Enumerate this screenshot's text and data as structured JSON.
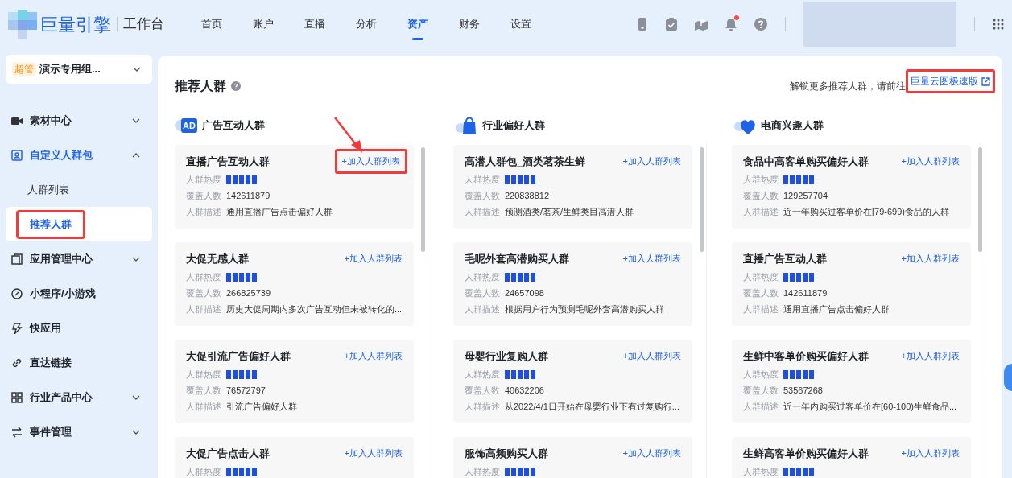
{
  "header": {
    "brand": "巨量引擎",
    "product": "工作台",
    "nav": [
      {
        "label": "首页",
        "selected": false
      },
      {
        "label": "账户",
        "selected": false
      },
      {
        "label": "直播",
        "selected": false
      },
      {
        "label": "分析",
        "selected": false
      },
      {
        "label": "资产",
        "selected": true
      },
      {
        "label": "财务",
        "selected": false
      },
      {
        "label": "设置",
        "selected": false
      }
    ],
    "notification_badge": true
  },
  "sidebar": {
    "account": {
      "badge": "超管",
      "name": "演示专用组..."
    },
    "items": [
      {
        "label": "素材中心",
        "expanded": false,
        "selected": false
      },
      {
        "label": "自定义人群包",
        "expanded": true,
        "selected": true,
        "children": [
          {
            "label": "人群列表",
            "selected": false,
            "highlighted": false
          },
          {
            "label": "推荐人群",
            "selected": true,
            "highlighted": true
          }
        ]
      },
      {
        "label": "应用管理中心",
        "expanded": false,
        "selected": false
      },
      {
        "label": "小程序/小游戏",
        "selected": false
      },
      {
        "label": "快应用",
        "selected": false
      },
      {
        "label": "直达链接",
        "selected": false
      },
      {
        "label": "行业产品中心",
        "expanded": false,
        "selected": false
      },
      {
        "label": "事件管理",
        "expanded": false,
        "selected": false
      }
    ]
  },
  "main": {
    "title": "推荐人群",
    "unlock_text": "解锁更多推荐人群，请前往",
    "unlock_link": {
      "label": "巨量云图极速版",
      "highlighted": true
    },
    "columns": [
      {
        "title": "广告互动人群",
        "icon_text": "AD",
        "cards": [
          {
            "name": "直播广告互动人群",
            "action": "+加入人群列表",
            "action_highlighted": true,
            "heat_label": "人群热度",
            "stars": 5,
            "coverage_label": "覆盖人数",
            "coverage": "142611879",
            "desc_label": "人群描述",
            "desc": "通用直播广告点击偏好人群"
          },
          {
            "name": "大促无感人群",
            "action": "+加入人群列表",
            "action_highlighted": false,
            "heat_label": "人群热度",
            "stars": 5,
            "coverage_label": "覆盖人数",
            "coverage": "266825739",
            "desc_label": "人群描述",
            "desc": "历史大促周期内多次广告互动但未被转化的..."
          },
          {
            "name": "大促引流广告偏好人群",
            "action": "+加入人群列表",
            "action_highlighted": false,
            "heat_label": "人群热度",
            "stars": 5,
            "coverage_label": "覆盖人数",
            "coverage": "76572797",
            "desc_label": "人群描述",
            "desc": "引流广告偏好人群"
          },
          {
            "name": "大促广告点击人群",
            "action": "+加入人群列表",
            "action_highlighted": false,
            "heat_label": "人群热度",
            "stars": 5
          }
        ]
      },
      {
        "title": "行业偏好人群",
        "cards": [
          {
            "name": "高潜人群包_酒类茗茶生鲜",
            "action": "+加入人群列表",
            "action_highlighted": false,
            "heat_label": "人群热度",
            "stars": 5,
            "coverage_label": "覆盖人数",
            "coverage": "220838812",
            "desc_label": "人群描述",
            "desc": "预测酒类/茗茶/生鲜类目高潜人群"
          },
          {
            "name": "毛呢外套高潜购买人群",
            "action": "+加入人群列表",
            "action_highlighted": false,
            "heat_label": "人群热度",
            "stars": 5,
            "coverage_label": "覆盖人数",
            "coverage": "24657098",
            "desc_label": "人群描述",
            "desc": "根据用户行为预测毛呢外套高潜购买人群"
          },
          {
            "name": "母婴行业复购人群",
            "action": "+加入人群列表",
            "action_highlighted": false,
            "heat_label": "人群热度",
            "stars": 5,
            "coverage_label": "覆盖人数",
            "coverage": "40632206",
            "desc_label": "人群描述",
            "desc": "从2022/4/1日开始在母婴行业下有过复购行..."
          },
          {
            "name": "服饰高频购买人群",
            "action": "+加入人群列表",
            "action_highlighted": false,
            "heat_label": "人群热度",
            "stars": 5
          }
        ]
      },
      {
        "title": "电商兴趣人群",
        "cards": [
          {
            "name": "食品中高客单购买偏好人群",
            "action": "+加入人群列表",
            "action_highlighted": false,
            "heat_label": "人群热度",
            "stars": 5,
            "coverage_label": "覆盖人数",
            "coverage": "129257704",
            "desc_label": "人群描述",
            "desc": "近一年购买过客单价在[79-699)食品的人群"
          },
          {
            "name": "直播广告互动人群",
            "action": "+加入人群列表",
            "action_highlighted": false,
            "heat_label": "人群热度",
            "stars": 5,
            "coverage_label": "覆盖人数",
            "coverage": "142611879",
            "desc_label": "人群描述",
            "desc": "通用直播广告点击偏好人群"
          },
          {
            "name": "生鲜中客单价购买偏好人群",
            "action": "+加入人群列表",
            "action_highlighted": false,
            "heat_label": "人群热度",
            "stars": 5,
            "coverage_label": "覆盖人数",
            "coverage": "53567268",
            "desc_label": "人群描述",
            "desc": "近一年内购买过客单价在[60-100)生鲜食品..."
          },
          {
            "name": "生鲜高客单价购买偏好人群",
            "action": "+加入人群列表",
            "action_highlighted": false,
            "heat_label": "人群热度",
            "stars": 5
          }
        ]
      }
    ]
  }
}
